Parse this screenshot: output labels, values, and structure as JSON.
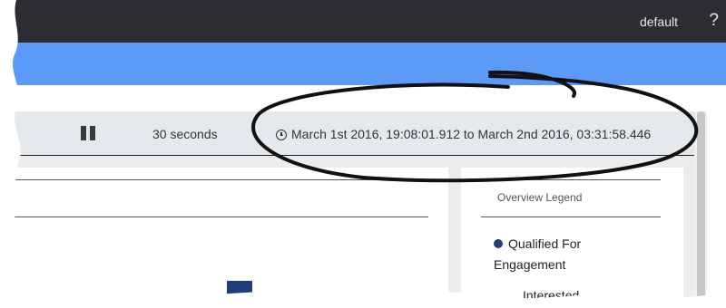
{
  "topbar": {
    "user": "default",
    "help_icon": "question-mark-icon",
    "background": "#2b2d31"
  },
  "accent_bar": {
    "color": "#5b9bf7"
  },
  "toolbar": {
    "pause_icon": "pause-icon",
    "refresh_interval": "30 seconds",
    "clock_icon": "clock-icon",
    "time_range": "March 1st 2016, 19:08:01.912 to March 2nd 2016, 03:31:58.446"
  },
  "legend": {
    "title": "Overview Legend",
    "items": [
      {
        "label": "Qualified For Engagement",
        "color": "#1f3d7a"
      },
      {
        "label": "Interested"
      }
    ]
  },
  "colors": {
    "bar": "#1f3d7a",
    "toolbar_bg": "#e6e9ec",
    "content_bg": "#ececec"
  }
}
